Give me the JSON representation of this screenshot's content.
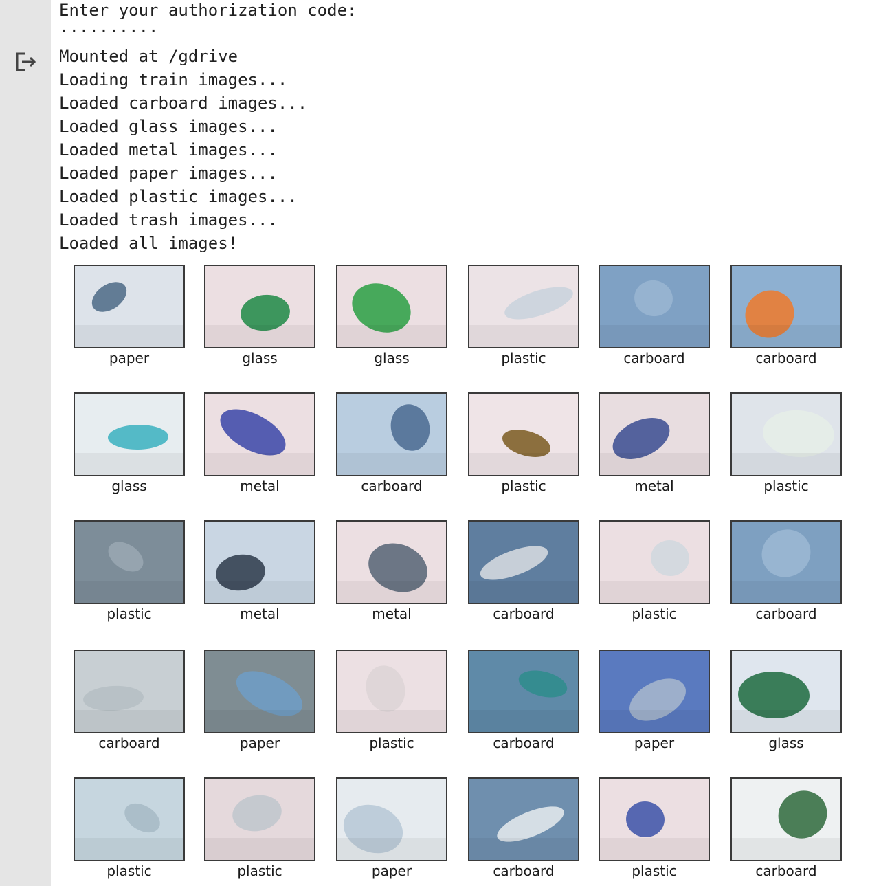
{
  "output": {
    "lines": [
      "Enter your authorization code:",
      "··········",
      "Mounted at /gdrive",
      "Loading train images...",
      "Loaded carboard images...",
      "Loaded glass images...",
      "Loaded metal images...",
      "Loaded paper images...",
      "Loaded plastic images...",
      "Loaded trash images...",
      "Loaded all images!"
    ],
    "icon": "output-redirect-icon"
  },
  "images": [
    {
      "label": "paper",
      "bg": "#dde3ea",
      "fg": "#4c6a86"
    },
    {
      "label": "glass",
      "bg": "#ecdfe2",
      "fg": "#1f8a45"
    },
    {
      "label": "glass",
      "bg": "#ecdfe2",
      "fg": "#2aa043"
    },
    {
      "label": "plastic",
      "bg": "#ece3e6",
      "fg": "#c9d2dc"
    },
    {
      "label": "carboard",
      "bg": "#7fa1c4",
      "fg": "#9ab6d2"
    },
    {
      "label": "carboard",
      "bg": "#8eb0d1",
      "fg": "#f07a2a"
    },
    {
      "label": "glass",
      "bg": "#e7edf0",
      "fg": "#3ab0c0"
    },
    {
      "label": "metal",
      "bg": "#ecdfe2",
      "fg": "#3b46a8"
    },
    {
      "label": "carboard",
      "bg": "#b9cde0",
      "fg": "#4a6a90"
    },
    {
      "label": "plastic",
      "bg": "#efe4e7",
      "fg": "#7a5a20"
    },
    {
      "label": "metal",
      "bg": "#e8dde0",
      "fg": "#3a4c90"
    },
    {
      "label": "plastic",
      "bg": "#dfe4ea",
      "fg": "#e6efe8"
    },
    {
      "label": "plastic",
      "bg": "#7d8d99",
      "fg": "#9aa8b3"
    },
    {
      "label": "metal",
      "bg": "#c9d6e3",
      "fg": "#2d3a4a"
    },
    {
      "label": "metal",
      "bg": "#ecdfe2",
      "fg": "#566474"
    },
    {
      "label": "carboard",
      "bg": "#5f7e9f",
      "fg": "#d9dde2"
    },
    {
      "label": "plastic",
      "bg": "#ecdfe2",
      "fg": "#d0d8de"
    },
    {
      "label": "carboard",
      "bg": "#7ea0c1",
      "fg": "#9cb8d3"
    },
    {
      "label": "carboard",
      "bg": "#c8cfd3",
      "fg": "#b5bec3"
    },
    {
      "label": "paper",
      "bg": "#7f8d93",
      "fg": "#6f9ec7"
    },
    {
      "label": "plastic",
      "bg": "#ece0e3",
      "fg": "#ddd3d6"
    },
    {
      "label": "carboard",
      "bg": "#5f8aa8",
      "fg": "#2e8c8c"
    },
    {
      "label": "paper",
      "bg": "#5a7abf",
      "fg": "#a9b8cc"
    },
    {
      "label": "glass",
      "bg": "#dfe6ee",
      "fg": "#1d6a3e"
    },
    {
      "label": "plastic",
      "bg": "#c6d6df",
      "fg": "#a6bac6"
    },
    {
      "label": "plastic",
      "bg": "#e5d9dc",
      "fg": "#c0c6cc"
    },
    {
      "label": "paper",
      "bg": "#e6ebef",
      "fg": "#b6c8d6"
    },
    {
      "label": "carboard",
      "bg": "#6f8fae",
      "fg": "#e8ecef"
    },
    {
      "label": "plastic",
      "bg": "#ecdfe2",
      "fg": "#3c52a8"
    },
    {
      "label": "carboard",
      "bg": "#eef1f2",
      "fg": "#2e6a3c"
    }
  ]
}
